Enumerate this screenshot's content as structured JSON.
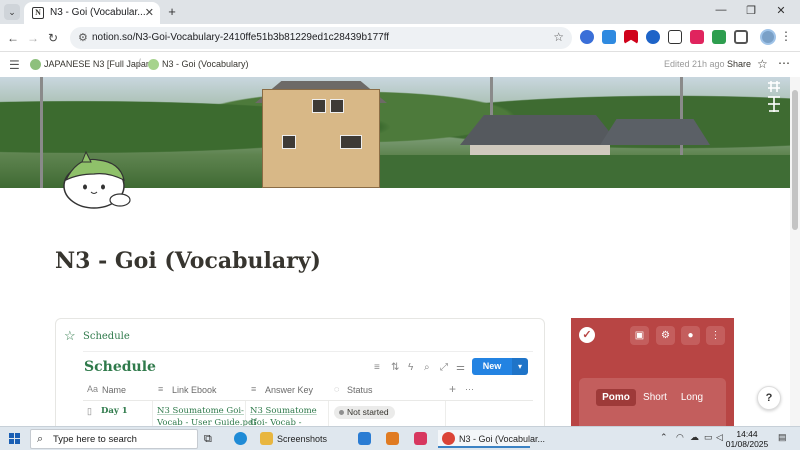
{
  "browser": {
    "tab_title": "N3 - Goi (Vocabular...",
    "tab_favicon": "N",
    "new_tab": "+",
    "url": "notion.so/N3-Goi-Vocabulary-2410ffe51b3b81229ed1c28439b177ff"
  },
  "topbar": {
    "workspace_crumb": "JAPANESE N3 [Full Japan]",
    "page_crumb": "N3 - Goi (Vocabulary)",
    "edited": "Edited 21h ago",
    "share_label": "Share"
  },
  "page": {
    "title": "N3 - Goi (Vocabulary)"
  },
  "schedule": {
    "heading": "Schedule",
    "db_title": "Schedule",
    "new_button": "New",
    "columns": [
      {
        "icon": "Aa",
        "label": "Name"
      },
      {
        "icon": "≡",
        "label": "Link Ebook"
      },
      {
        "icon": "≡",
        "label": "Answer Key"
      },
      {
        "icon": "◌",
        "label": "Status"
      }
    ],
    "rows": [
      {
        "name": "Day 1",
        "link_ebook_line1": "N3 Soumatome Goi-",
        "link_ebook_line2": "Vocab - User Guide.pdf",
        "answer_key_line1": "N3 Soumatome",
        "answer_key_line2": "Goi- Vocab -",
        "status": "Not started"
      }
    ]
  },
  "pomodoro": {
    "tabs": [
      "Pomo",
      "Short",
      "Long"
    ],
    "active_tab": "Pomo",
    "accent_color": "#b84544"
  },
  "help_button": "?",
  "taskbar": {
    "search_placeholder": "Type here to search",
    "apps": [
      {
        "label": "Screenshots",
        "icon": "folder-icon"
      },
      {
        "label": "N3 - Goi (Vocabular...",
        "icon": "chrome-icon"
      }
    ],
    "time": "14:44",
    "date": "01/08/2025"
  }
}
